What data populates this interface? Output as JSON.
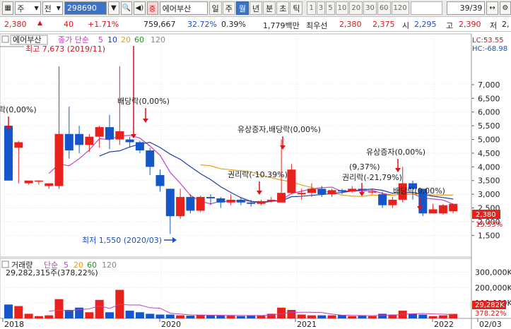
{
  "toolbar": {
    "period": "주",
    "type": "전",
    "code": "298690",
    "name": "에어부산",
    "periods": [
      "일",
      "주",
      "월",
      "년",
      "분",
      "초",
      "틱"
    ],
    "selected_period": "월",
    "nums": [
      "1",
      "3",
      "5",
      "10",
      "20",
      "30",
      "60",
      "120"
    ],
    "page": "39/39"
  },
  "quote": {
    "price": "2,380",
    "change": "40",
    "change_pct": "+1.71%",
    "volume": "759,667",
    "vol_ratio": "32.72%",
    "turnover": "0.39%",
    "amount": "1,779백만",
    "ask_label": "최우선",
    "ask": "2,380",
    "bid": "2,375",
    "open_label": "시",
    "open": "2,295",
    "high_label": "고",
    "high": "2,390",
    "low_label": "저",
    "low": "2,"
  },
  "price_panel": {
    "title": "에어부산",
    "ma_label": "종가 단순",
    "ma": [
      "5",
      "10",
      "20",
      "60",
      "120"
    ],
    "lc": "LC:53.55",
    "hc": "HC:-68.98",
    "yticks": [
      "7,000",
      "6,500",
      "6,000",
      "5,500",
      "5,000",
      "4,500",
      "4,000",
      "3,500",
      "3,000",
      "2,500",
      "2,000",
      "1,500"
    ],
    "current_price": "2,380",
    "current_pct": "15.53%",
    "annotations": {
      "high": "최고 7,673 (2019/11)",
      "low": "최저 1,550 (2020/03)",
      "div0": "락(0,00%)",
      "div1": "배당락(0,00%)",
      "rights1": "유상증자,배당락(0,00%)",
      "rights2": "권리락(-10.39%)",
      "rights3a": "(9,37%)",
      "rights3b": "권리락(-21,79%)",
      "rights4": "유상증자(0,00%)",
      "div2": "배당락(0,00%)"
    }
  },
  "volume_panel": {
    "title": "거래량",
    "ma_label": "단순",
    "ma": [
      "5",
      "20",
      "60",
      "120"
    ],
    "info": "29,282,315주(378,22%)",
    "yticks": [
      "300,000K",
      "200,000K",
      "100,000K"
    ],
    "current": "29,282K",
    "current_pct": "378.22%"
  },
  "xaxis": [
    "2018",
    "2020",
    "2021",
    "2022",
    "02/03"
  ],
  "colors": {
    "up": "#e8211c",
    "down": "#1556c9",
    "ma5": "#c040c0",
    "ma10": "#1a3fa8",
    "ma20": "#e8a010"
  },
  "chart_data": {
    "type": "candlestick",
    "candles": [
      [
        5500,
        3500,
        4700,
        3500
      ],
      [
        4700,
        4900,
        4950,
        3400
      ],
      [
        3400,
        3500,
        3500,
        3350
      ],
      [
        3500,
        3500,
        3500,
        3350
      ],
      [
        3300,
        3400,
        3400,
        3200
      ],
      [
        3300,
        5200,
        7673,
        3200
      ],
      [
        5200,
        4600,
        6200,
        4300
      ],
      [
        5200,
        4800,
        5500,
        4500
      ],
      [
        4800,
        5100,
        5200,
        4550
      ],
      [
        5100,
        5450,
        5500,
        4700
      ],
      [
        5450,
        5000,
        5900,
        4650
      ],
      [
        5000,
        5300,
        7673,
        4800
      ],
      [
        5000,
        4900,
        5100,
        4700
      ],
      [
        4900,
        4600,
        4950,
        4500
      ],
      [
        4600,
        4000,
        4700,
        3700
      ],
      [
        3700,
        3300,
        3900,
        3100
      ],
      [
        3200,
        2200,
        3200,
        1550
      ],
      [
        2200,
        2900,
        3200,
        2100
      ],
      [
        2900,
        2400,
        3000,
        2300
      ],
      [
        2400,
        2900,
        2950,
        2350
      ],
      [
        2900,
        2850,
        3000,
        2600
      ],
      [
        2850,
        2700,
        2900,
        2500
      ],
      [
        2700,
        2800,
        3000,
        2600
      ],
      [
        2800,
        2700,
        2900,
        2600
      ],
      [
        2700,
        2650,
        2800,
        2550
      ],
      [
        2650,
        2750,
        2800,
        2600
      ],
      [
        2750,
        2800,
        2900,
        2700
      ],
      [
        2700,
        3050,
        5000,
        2700
      ],
      [
        3050,
        3900,
        4100,
        3000
      ],
      [
        3000,
        3050,
        3200,
        2800
      ],
      [
        3050,
        3200,
        3400,
        2900
      ],
      [
        3200,
        3000,
        3300,
        2900
      ],
      [
        3000,
        3150,
        3200,
        2900
      ],
      [
        3150,
        3100,
        3200,
        3000
      ],
      [
        3100,
        3200,
        3300,
        3050
      ],
      [
        3200,
        3150,
        3200,
        3050
      ],
      [
        3100,
        3100,
        3200,
        3000
      ],
      [
        3000,
        2600,
        3100,
        2500
      ],
      [
        2600,
        2800,
        2900,
        2500
      ],
      [
        2800,
        3400,
        4000,
        2700
      ],
      [
        3400,
        3200,
        3500,
        2800
      ],
      [
        3200,
        2300,
        3200,
        2200
      ],
      [
        2300,
        2450,
        2650,
        2300
      ],
      [
        2300,
        2600,
        2650,
        2250
      ],
      [
        2380,
        2650,
        2650,
        2300
      ]
    ],
    "volume": [
      90000,
      80000,
      30000,
      15000,
      20000,
      125000,
      55000,
      70000,
      40000,
      120000,
      40000,
      185000,
      50000,
      40000,
      30000,
      25000,
      25000,
      20000,
      18000,
      22000,
      20000,
      20000,
      18000,
      15000,
      20000,
      20000,
      30000,
      70000,
      55000,
      25000,
      20000,
      20000,
      20000,
      22000,
      15000,
      18000,
      15000,
      30000,
      25000,
      50000,
      30000,
      25000,
      15000,
      20000,
      29282
    ],
    "ylim": [
      1200,
      7900
    ],
    "vol_ylim": [
      0,
      380000
    ]
  }
}
